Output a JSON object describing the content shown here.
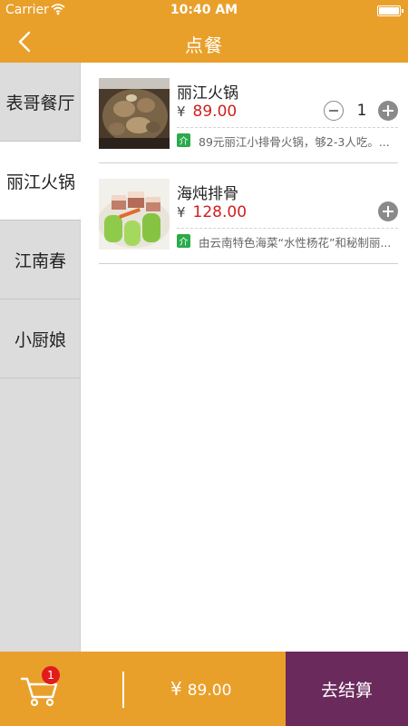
{
  "status": {
    "carrier": "Carrier",
    "time": "10:40 AM"
  },
  "nav": {
    "title": "点餐"
  },
  "sidebar": {
    "items": [
      {
        "label": "表哥餐厅",
        "active": false
      },
      {
        "label": "丽江火锅",
        "active": true
      },
      {
        "label": "江南春",
        "active": false
      },
      {
        "label": "小厨娘",
        "active": false
      }
    ]
  },
  "dishes": [
    {
      "name": "丽江火锅",
      "currency": "¥",
      "price": "89.00",
      "quantity": "1",
      "intro_badge": "介",
      "description": "89元丽江小排骨火锅，够2-3人吃。..."
    },
    {
      "name": "海炖排骨",
      "currency": "¥",
      "price": "128.00",
      "intro_badge": "介",
      "description": "由云南特色海菜“水性杨花”和秘制丽..."
    }
  ],
  "cart": {
    "count": "1",
    "currency": "¥",
    "total": "89.00"
  },
  "checkout": {
    "label": "去结算"
  },
  "colors": {
    "accent": "#E9A02A",
    "checkout_bg": "#6A2A5C",
    "price": "#D01F1F",
    "badge": "#E21B1B",
    "intro": "#2BAA4A"
  }
}
